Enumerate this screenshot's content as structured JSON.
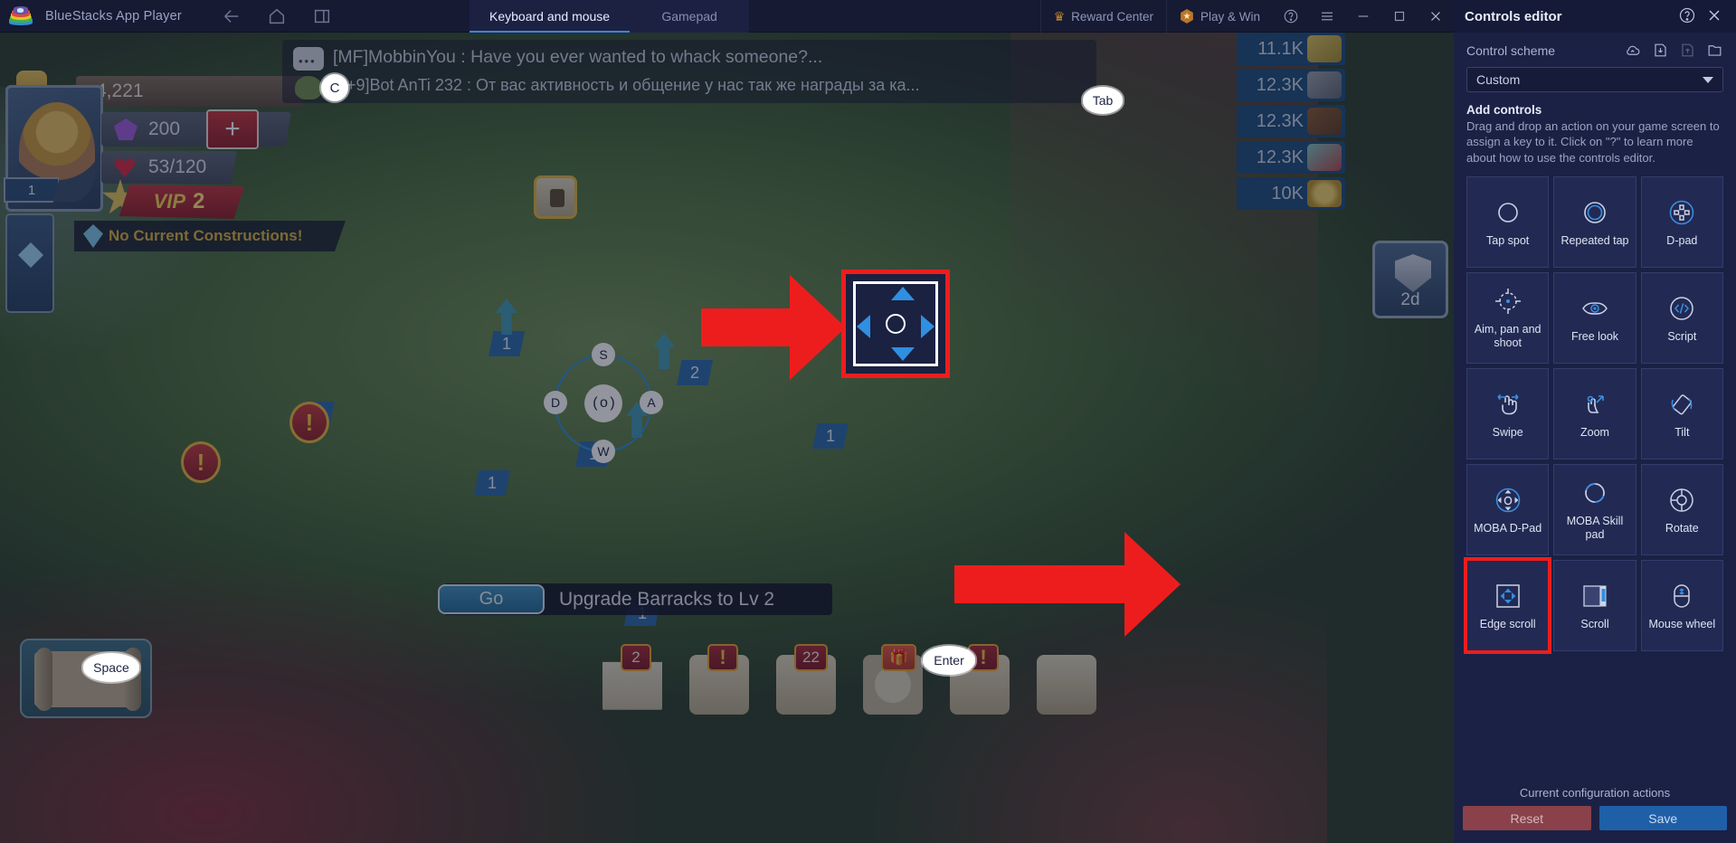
{
  "titlebar": {
    "app_title": "BlueStacks App Player",
    "nav": [
      {
        "name": "back-arrow-icon",
        "label": "Back"
      },
      {
        "name": "home-icon",
        "label": "Home"
      },
      {
        "name": "multi-instance-icon",
        "label": "Multi-instance"
      }
    ],
    "tabs": [
      {
        "label": "Keyboard and mouse",
        "active": true
      },
      {
        "label": "Gamepad",
        "active": false
      }
    ],
    "reward_center": "Reward Center",
    "play_and_win": "Play & Win",
    "window_buttons": [
      "help-icon",
      "menu-icon",
      "minimize-icon",
      "maximize-icon",
      "close-icon"
    ]
  },
  "game": {
    "player": {
      "power": "4,221",
      "gems": "200",
      "hp": "53/120",
      "vip_label": "VIP",
      "vip_level": "2",
      "avatar_level": "1",
      "construction_status": "No Current Constructions!"
    },
    "chat": [
      "[MF]MobbinYou : Have you ever wanted to whack someone?...",
      "[3+9]Bot AnTi 232 : От вас активность и общение у нас так же награды за ка..."
    ],
    "resources": [
      {
        "value": "11.1K",
        "icon": "wheat-icon"
      },
      {
        "value": "12.3K",
        "icon": "stone-icon"
      },
      {
        "value": "12.3K",
        "icon": "wood-icon"
      },
      {
        "value": "12.3K",
        "icon": "gem-ore-icon"
      },
      {
        "value": "10K",
        "icon": "gold-coin-icon"
      }
    ],
    "shield_timer": "2d",
    "quest": {
      "go_label": "Go",
      "text": "Upgrade Barracks to Lv 2"
    },
    "bottom_badges": [
      "2",
      "!",
      "22",
      "!"
    ],
    "map_markers": [
      "1",
      "1",
      "2",
      "1",
      "1",
      "1"
    ],
    "keycaps": [
      {
        "key": "C",
        "at": "chat"
      },
      {
        "key": "Tab",
        "at": "resources"
      },
      {
        "key": "Space",
        "at": "minimap"
      },
      {
        "key": "Enter",
        "at": "bag"
      }
    ],
    "joystick": {
      "up": "S",
      "down": "W",
      "right": "A",
      "left": "D",
      "center": "( o )"
    }
  },
  "panel": {
    "title": "Controls editor",
    "help_icon": "help-circle-icon",
    "close_icon": "close-icon",
    "control_scheme_label": "Control scheme",
    "scheme_icons": [
      "cloud-sync-icon",
      "import-icon",
      "export-icon",
      "folder-icon"
    ],
    "selected_scheme": "Custom",
    "add_controls_title": "Add controls",
    "add_controls_desc": "Drag and drop an action on your game screen to assign a key to it. Click on \"?\" to learn more about how to use the controls editor.",
    "controls": [
      {
        "label": "Tap spot",
        "icon": "tap-spot-icon",
        "highlighted": false
      },
      {
        "label": "Repeated tap",
        "icon": "repeated-tap-icon",
        "highlighted": false
      },
      {
        "label": "D-pad",
        "icon": "dpad-icon",
        "highlighted": false
      },
      {
        "label": "Aim, pan and shoot",
        "icon": "aim-pan-shoot-icon",
        "highlighted": false
      },
      {
        "label": "Free look",
        "icon": "free-look-icon",
        "highlighted": false
      },
      {
        "label": "Script",
        "icon": "script-icon",
        "highlighted": false
      },
      {
        "label": "Swipe",
        "icon": "swipe-icon",
        "highlighted": false
      },
      {
        "label": "Zoom",
        "icon": "zoom-icon",
        "highlighted": false
      },
      {
        "label": "Tilt",
        "icon": "tilt-icon",
        "highlighted": false
      },
      {
        "label": "MOBA D-Pad",
        "icon": "moba-dpad-icon",
        "highlighted": false
      },
      {
        "label": "MOBA Skill pad",
        "icon": "moba-skill-pad-icon",
        "highlighted": false
      },
      {
        "label": "Rotate",
        "icon": "rotate-icon",
        "highlighted": false
      },
      {
        "label": "Edge scroll",
        "icon": "edge-scroll-icon",
        "highlighted": true
      },
      {
        "label": "Scroll",
        "icon": "scroll-icon",
        "highlighted": false
      },
      {
        "label": "Mouse wheel",
        "icon": "mouse-wheel-icon",
        "highlighted": false
      }
    ],
    "footer_label": "Current configuration actions",
    "reset_label": "Reset",
    "save_label": "Save"
  },
  "colors": {
    "accent_blue": "#3b82e0",
    "panel_bg": "#1b2145",
    "highlight_red": "#ee1d1d",
    "save_blue": "#1f5fa8",
    "reset_red": "#8a4149"
  }
}
